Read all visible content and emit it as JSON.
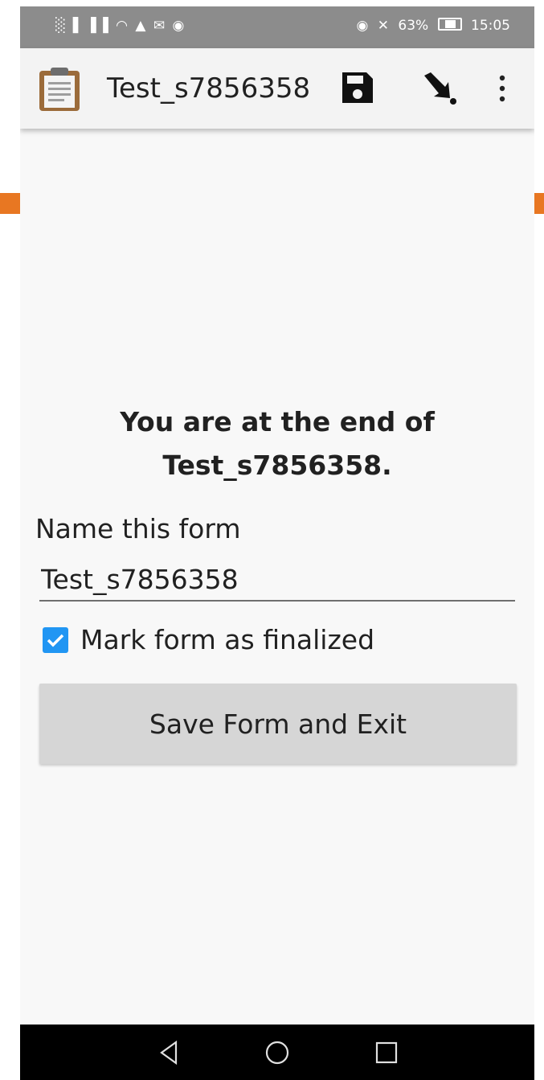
{
  "status_bar": {
    "left_icons": "░▐ ▐▐ ◠ ▲ ✉ ◉",
    "eye_icon": "◉",
    "bell_off_icon": "✕",
    "battery_percent": "63%",
    "battery_level": 0.63,
    "time": "15:05"
  },
  "app_bar": {
    "title": "Test_s7856358",
    "icons": [
      "clipboard-icon",
      "save-icon",
      "jump-icon",
      "overflow-menu-icon"
    ]
  },
  "main": {
    "end_message_line1": "You are at the end of",
    "end_message_line2": "Test_s7856358.",
    "name_label": "Name this form",
    "name_value": "Test_s7856358",
    "finalize_label": "Mark form as finalized",
    "finalize_checked": true,
    "save_button_label": "Save Form and Exit"
  },
  "colors": {
    "accent": "#2196f3",
    "marker": "#e87722",
    "status_bar": "#8c8c8c",
    "app_bar": "#f3f3f3"
  }
}
